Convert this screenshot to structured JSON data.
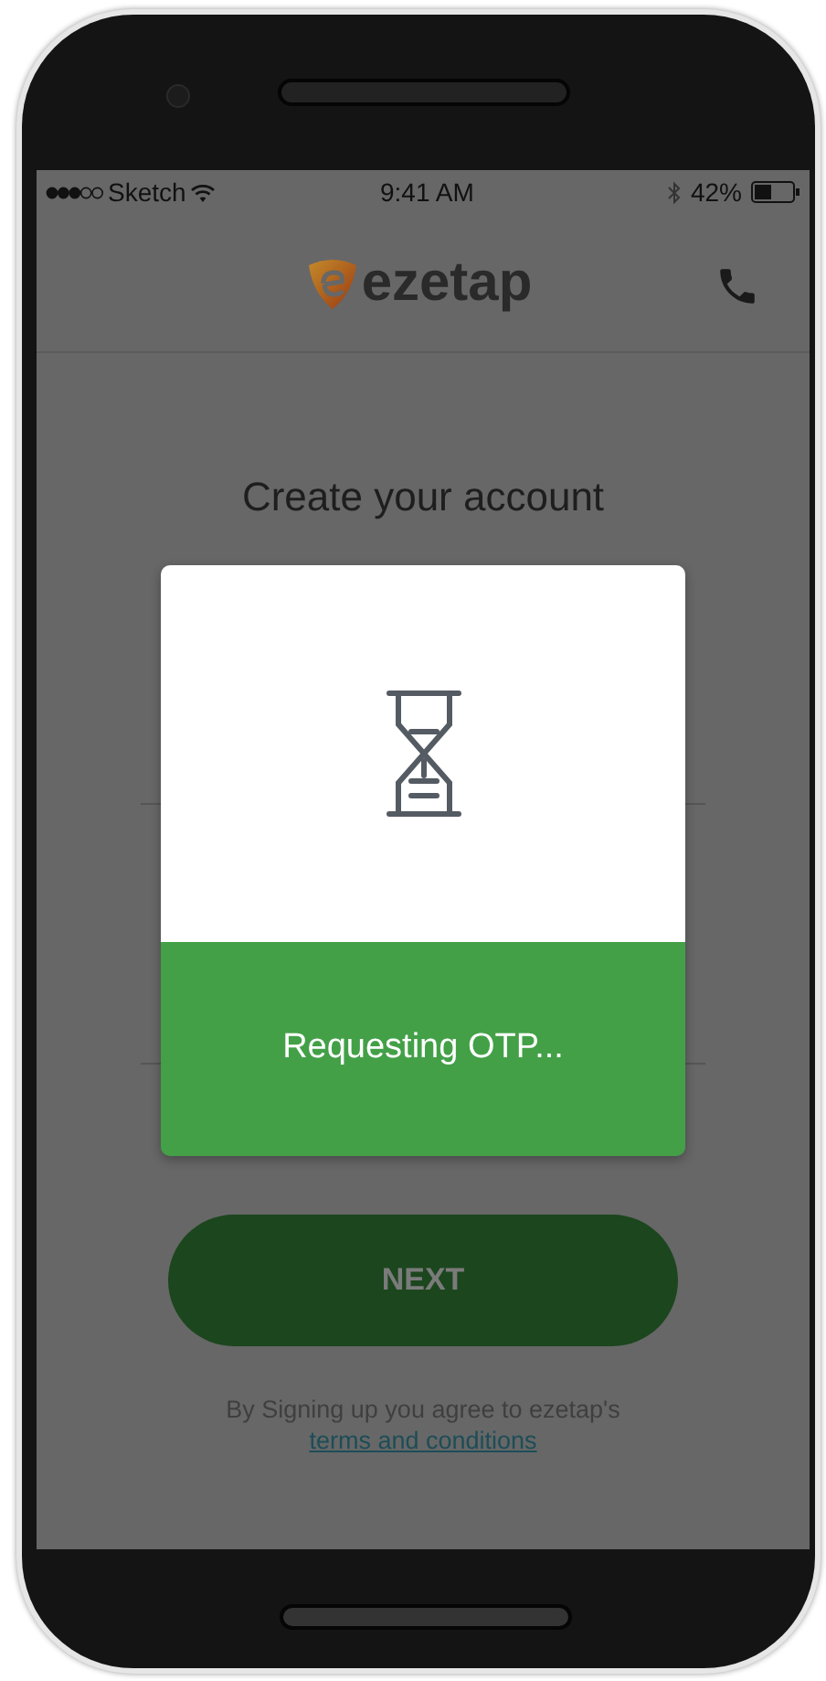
{
  "status_bar": {
    "carrier": "Sketch",
    "time": "9:41 AM",
    "battery": "42%"
  },
  "header": {
    "logo_text": "ezetap"
  },
  "title": "Create your account",
  "dialog": {
    "message": "Requesting OTP..."
  },
  "next_button": {
    "label": "NEXT"
  },
  "terms": {
    "text": "By Signing up you agree to ezetap's",
    "link": "terms and conditions"
  }
}
